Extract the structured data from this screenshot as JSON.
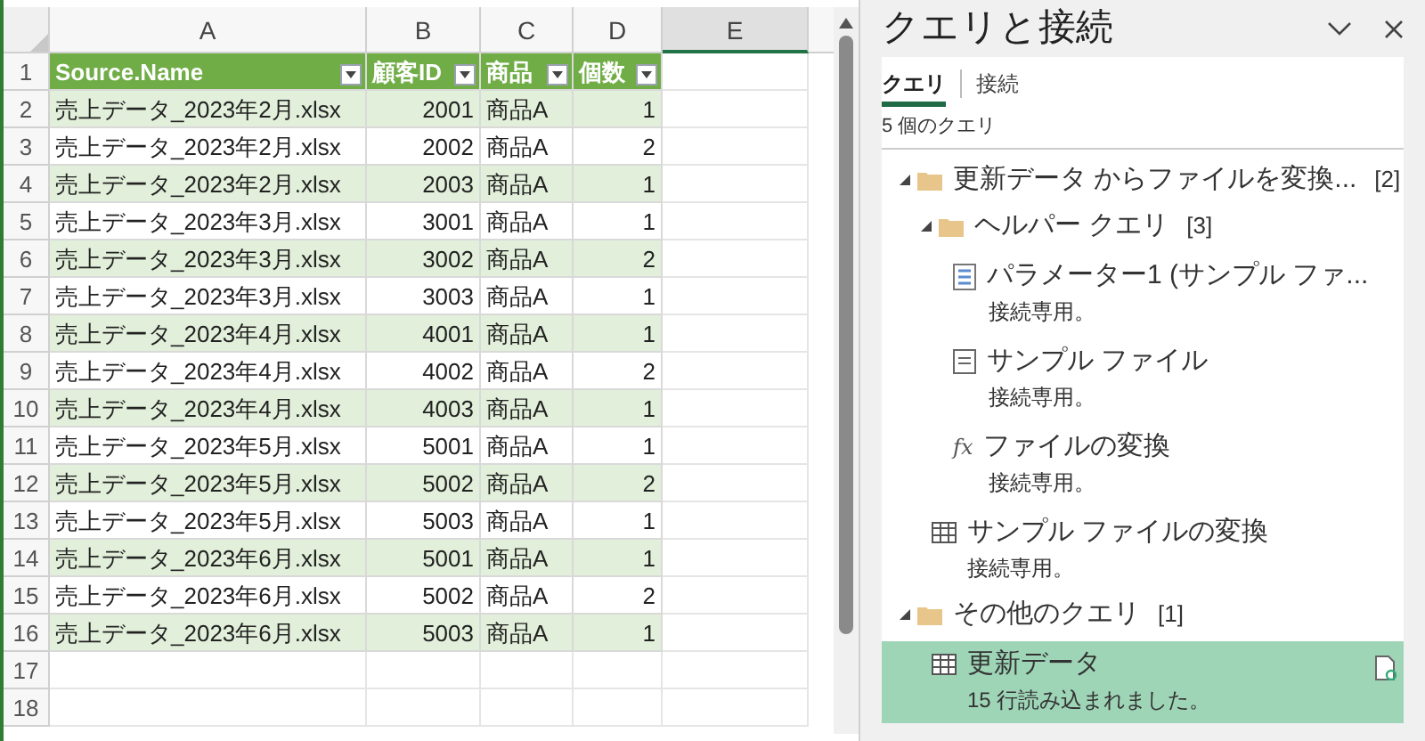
{
  "sheet": {
    "column_letters": [
      "A",
      "B",
      "C",
      "D",
      "E"
    ],
    "header_row": {
      "number": "1",
      "cells": [
        "Source.Name",
        "顧客ID",
        "商品",
        "個数"
      ]
    },
    "rows": [
      {
        "number": "2",
        "cells": [
          "売上データ_2023年2月.xlsx",
          "2001",
          "商品A",
          "1"
        ]
      },
      {
        "number": "3",
        "cells": [
          "売上データ_2023年2月.xlsx",
          "2002",
          "商品A",
          "2"
        ]
      },
      {
        "number": "4",
        "cells": [
          "売上データ_2023年2月.xlsx",
          "2003",
          "商品A",
          "1"
        ]
      },
      {
        "number": "5",
        "cells": [
          "売上データ_2023年3月.xlsx",
          "3001",
          "商品A",
          "1"
        ]
      },
      {
        "number": "6",
        "cells": [
          "売上データ_2023年3月.xlsx",
          "3002",
          "商品A",
          "2"
        ]
      },
      {
        "number": "7",
        "cells": [
          "売上データ_2023年3月.xlsx",
          "3003",
          "商品A",
          "1"
        ]
      },
      {
        "number": "8",
        "cells": [
          "売上データ_2023年4月.xlsx",
          "4001",
          "商品A",
          "1"
        ]
      },
      {
        "number": "9",
        "cells": [
          "売上データ_2023年4月.xlsx",
          "4002",
          "商品A",
          "2"
        ]
      },
      {
        "number": "10",
        "cells": [
          "売上データ_2023年4月.xlsx",
          "4003",
          "商品A",
          "1"
        ]
      },
      {
        "number": "11",
        "cells": [
          "売上データ_2023年5月.xlsx",
          "5001",
          "商品A",
          "1"
        ]
      },
      {
        "number": "12",
        "cells": [
          "売上データ_2023年5月.xlsx",
          "5002",
          "商品A",
          "2"
        ]
      },
      {
        "number": "13",
        "cells": [
          "売上データ_2023年5月.xlsx",
          "5003",
          "商品A",
          "1"
        ]
      },
      {
        "number": "14",
        "cells": [
          "売上データ_2023年6月.xlsx",
          "5001",
          "商品A",
          "1"
        ]
      },
      {
        "number": "15",
        "cells": [
          "売上データ_2023年6月.xlsx",
          "5002",
          "商品A",
          "2"
        ]
      },
      {
        "number": "16",
        "cells": [
          "売上データ_2023年6月.xlsx",
          "5003",
          "商品A",
          "1"
        ]
      }
    ],
    "empty_rows": [
      "17",
      "18"
    ]
  },
  "panel": {
    "title": "クエリと接続",
    "tabs": [
      {
        "label": "クエリ",
        "selected": true
      },
      {
        "label": "接続",
        "selected": false
      }
    ],
    "count": "5 個のクエリ",
    "tree": [
      {
        "kind": "folder",
        "label": "更新データ からファイルを変換...",
        "count": "[2]",
        "expanded": true,
        "children": [
          {
            "kind": "folder",
            "label": "ヘルパー クエリ",
            "count": "[3]",
            "expanded": true,
            "children": [
              {
                "kind": "parameter",
                "label": "パラメーター1 (サンプル ファ...",
                "status": "接続専用。",
                "selected": false
              },
              {
                "kind": "list",
                "label": "サンプル ファイル",
                "status": "接続専用。",
                "selected": false
              },
              {
                "kind": "function",
                "icon_text": "fx",
                "label": "ファイルの変換",
                "status": "接続専用。",
                "selected": false
              }
            ]
          },
          {
            "kind": "table",
            "label": "サンプル ファイルの変換",
            "status": "接続専用。",
            "selected": false
          }
        ]
      },
      {
        "kind": "folder",
        "label": "その他のクエリ",
        "count": "[1]",
        "expanded": true,
        "children": [
          {
            "kind": "table",
            "label": "更新データ",
            "status": "15 行読み込まれました。",
            "selected": true
          }
        ]
      }
    ]
  }
}
